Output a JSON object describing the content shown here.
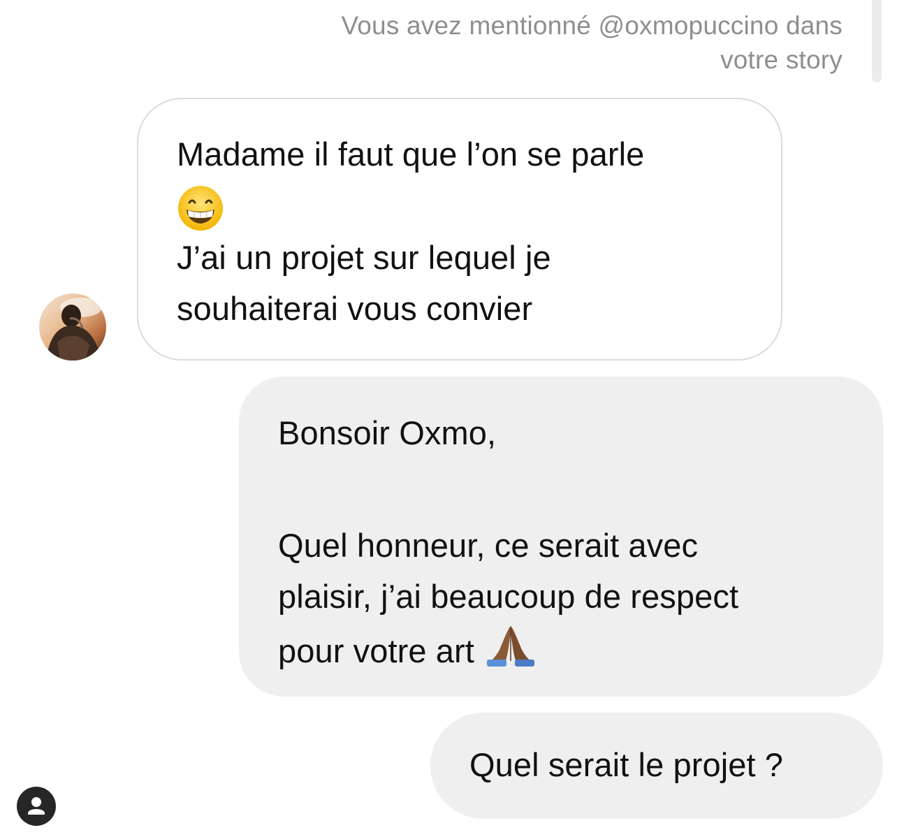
{
  "header": {
    "mention_line1": "Vous avez mentionné @oxmopuccino dans",
    "mention_line2": "votre story"
  },
  "messages": [
    {
      "sender": "contact",
      "lines": [
        "Madame il faut que l’on se parle",
        "J’ai un projet sur lequel  je",
        "souhaiterai vous convier"
      ],
      "emoji": "grinning-face-icon"
    },
    {
      "sender": "me",
      "lines": [
        "Bonsoir Oxmo,",
        "Quel honneur, ce serait avec",
        "plaisir, j’ai beaucoup de respect",
        "pour votre art"
      ],
      "emoji": "folded-hands-icon"
    },
    {
      "sender": "me",
      "lines": [
        "Quel serait le projet ?"
      ]
    }
  ],
  "icons": {
    "avatar": "contact-avatar",
    "badge": "profile-user-icon"
  },
  "colors": {
    "received_bubble_border": "#dbdbdb",
    "sent_bubble_bg": "#efefef",
    "meta_text": "#8e8e8e",
    "message_text": "#111111"
  }
}
